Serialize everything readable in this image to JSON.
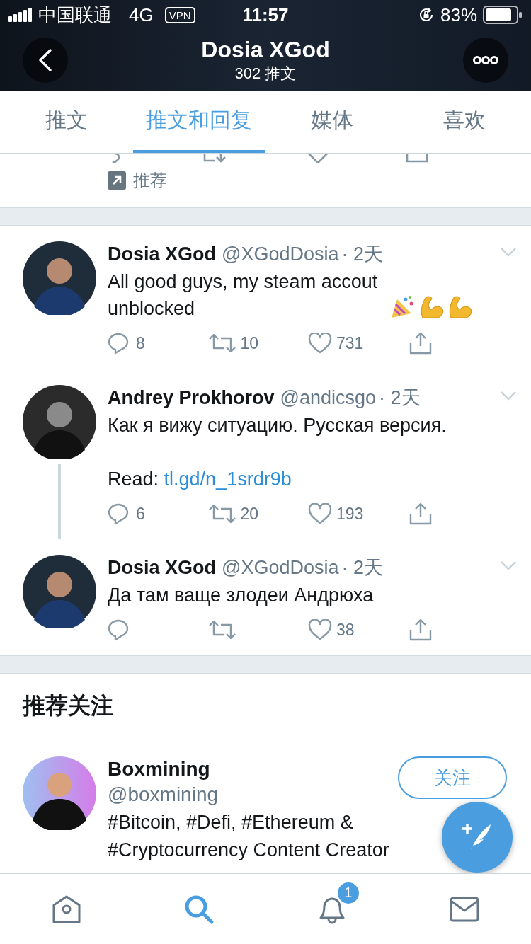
{
  "status_bar": {
    "carrier": "中国联通",
    "network": "4G",
    "vpn": "VPN",
    "time": "11:57",
    "battery": "83%"
  },
  "header": {
    "title": "Dosia XGod",
    "subtitle": "302 推文"
  },
  "tabs": [
    {
      "label": "推文",
      "selected": false
    },
    {
      "label": "推文和回复",
      "selected": true
    },
    {
      "label": "媒体",
      "selected": false
    },
    {
      "label": "喜欢",
      "selected": false
    }
  ],
  "partial_tweet": {
    "tag": "推荐"
  },
  "tweets": [
    {
      "name": "Dosia XGod",
      "handle": "@XGodDosia",
      "time": "· 2天",
      "text": "All good guys, my steam accout unblocked",
      "emoji": [
        {
          "kind": "party"
        },
        {
          "kind": "flex"
        },
        {
          "kind": "flex"
        }
      ],
      "replies": "8",
      "retweets": "10",
      "likes": "731",
      "thread_line": false
    },
    {
      "name": "Andrey Prokhorov",
      "handle": "@andicsgo",
      "time": "· 2天",
      "text": "Как я вижу ситуацию. Русская версия.",
      "link_prefix": "Read:",
      "link": "tl.gd/n_1srdr9b",
      "replies": "6",
      "retweets": "20",
      "likes": "193",
      "thread_line": true
    },
    {
      "name": "Dosia XGod",
      "handle": "@XGodDosia",
      "time": "· 2天",
      "text": "Да там ваще злодеи Андрюха",
      "likes": "38",
      "thread_line": false
    }
  ],
  "suggestions": {
    "title": "推荐关注",
    "users": [
      {
        "name": "Boxmining",
        "handle": "@boxmining",
        "bio": "#Bitcoin, #Defi, #Ethereum & #Cryptocurrency Content Creator",
        "follow": "关注"
      }
    ]
  },
  "nav": [
    {
      "kind": "home",
      "selected": false
    },
    {
      "kind": "search",
      "selected": true
    },
    {
      "kind": "bell",
      "selected": false,
      "badge": "1"
    },
    {
      "kind": "mail",
      "selected": false
    }
  ]
}
